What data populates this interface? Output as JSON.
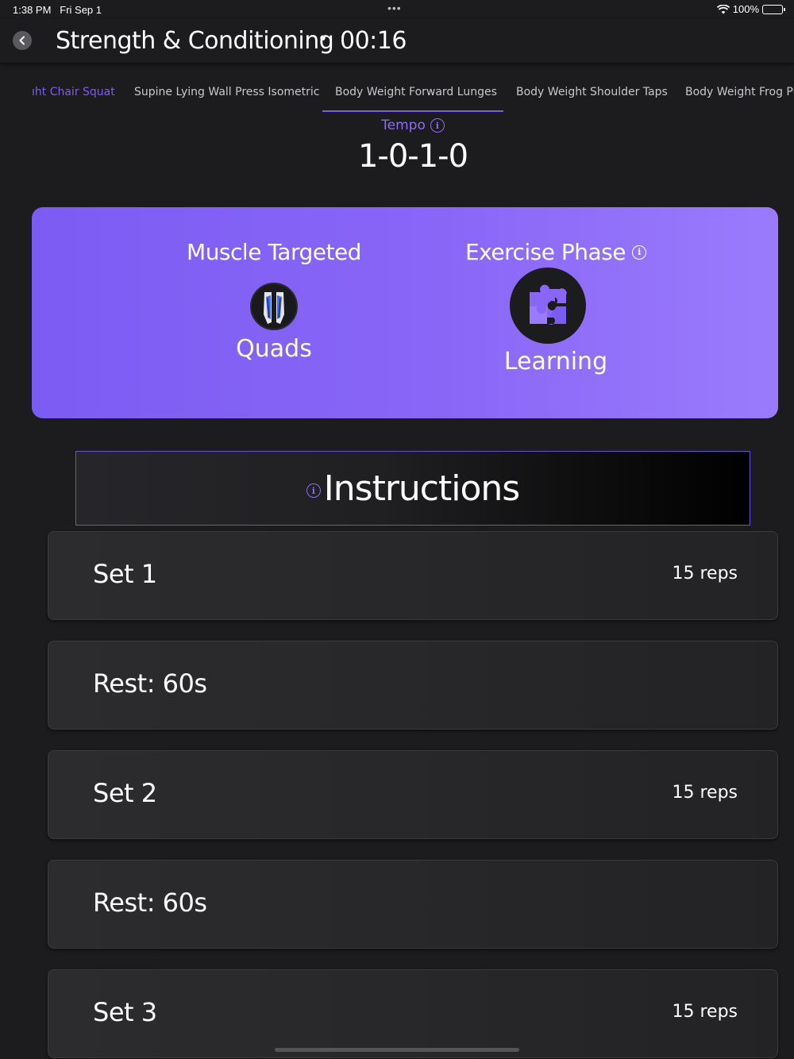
{
  "status_bar": {
    "time": "1:38 PM",
    "date": "Fri Sep 1",
    "battery": "100%",
    "battery_level": 1.0
  },
  "header": {
    "title": "Strength & Conditioning",
    "separator": "•",
    "timer": "00:16"
  },
  "tabs": [
    {
      "label": "ıht Chair Squat"
    },
    {
      "label": "Supine Lying Wall Press Isometric"
    },
    {
      "label": "Body Weight Forward Lunges",
      "selected": true
    },
    {
      "label": "Body Weight Shoulder Taps"
    },
    {
      "label": "Body Weight Frog Pu"
    }
  ],
  "tempo": {
    "label": "Tempo",
    "value": "1-0-1-0"
  },
  "exercise_card": {
    "muscle": {
      "heading": "Muscle Targeted",
      "value": "Quads",
      "icon": "quads-muscle-icon"
    },
    "phase": {
      "heading": "Exercise Phase",
      "value": "Learning",
      "icon": "puzzle-icon"
    }
  },
  "instructions": {
    "label": "Instructions"
  },
  "sets": [
    {
      "title": "Set 1",
      "reps": "15 reps"
    },
    {
      "title": "Rest: 60s",
      "reps": ""
    },
    {
      "title": "Set 2",
      "reps": "15 reps"
    },
    {
      "title": "Rest: 60s",
      "reps": ""
    },
    {
      "title": "Set 3",
      "reps": "15 reps"
    }
  ],
  "colors": {
    "accent": "#7b5cf3",
    "background": "#1c1c1e",
    "row": "#2c2c2e"
  }
}
